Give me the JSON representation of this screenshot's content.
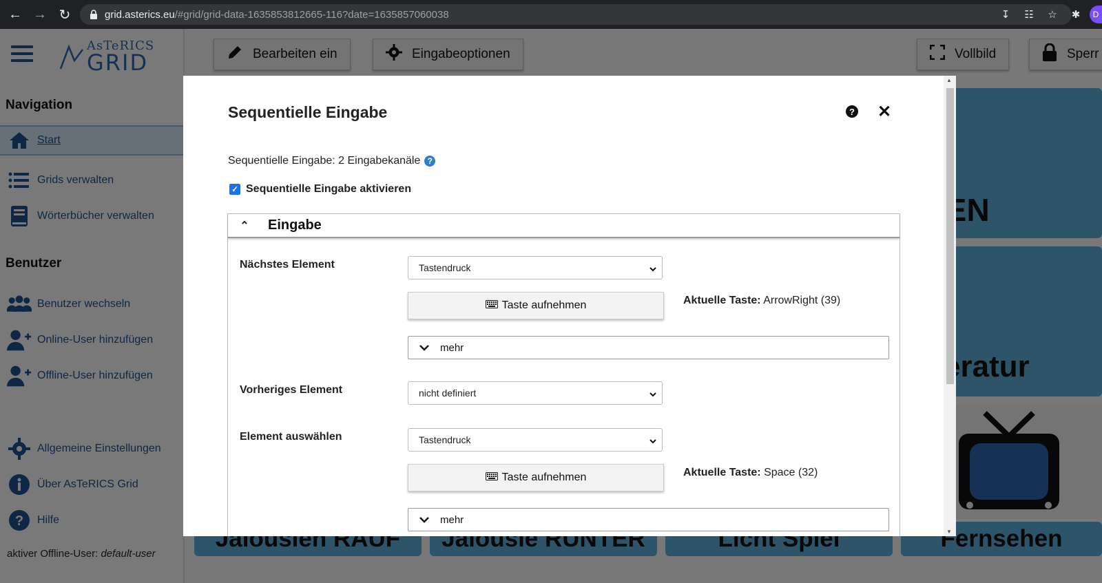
{
  "browser": {
    "url_host": "grid.asterics.eu",
    "url_path": "/#grid/grid-data-1635853812665-116?date=1635857060038",
    "profile_initial": "D"
  },
  "logo": {
    "sup": "AsTeRICS",
    "main": "GRID"
  },
  "sidebar": {
    "nav_title": "Navigation",
    "nav_items": [
      {
        "label": "Start",
        "icon": "home-icon"
      },
      {
        "label": "Grids verwalten",
        "icon": "list-icon"
      },
      {
        "label": "Wörterbücher verwalten",
        "icon": "book-icon"
      }
    ],
    "user_title": "Benutzer",
    "user_items": [
      {
        "label": "Benutzer wechseln",
        "icon": "users-icon"
      },
      {
        "label": "Online-User hinzufügen",
        "icon": "user-plus-icon"
      },
      {
        "label": "Offline-User hinzufügen",
        "icon": "user-plus-icon"
      }
    ],
    "bottom_items": [
      {
        "label": "Allgemeine Einstellungen",
        "icon": "gear-icon"
      },
      {
        "label": "Über AsTeRICS Grid",
        "icon": "info-icon"
      },
      {
        "label": "Hilfe",
        "icon": "help-icon"
      }
    ],
    "offline_user_label": "aktiver Offline-User:",
    "offline_user_name": "default-user"
  },
  "toolbar": {
    "edit_label": "Bearbeiten ein",
    "input_options_label": "Eingabeoptionen",
    "fullscreen_label": "Vollbild",
    "lock_label": "Sperr"
  },
  "grid_tiles": {
    "tile_1": "IEN",
    "tile_2": "eratur",
    "bottom": [
      "Jalousien RAUF",
      "Jalousie RUNTER",
      "Licht Spiel",
      "Fernsehen"
    ]
  },
  "modal": {
    "title": "Sequentielle Eingabe",
    "subline": "Sequentielle Eingabe: 2 Eingabekanäle",
    "enable_checkbox_label": "Sequentielle Eingabe aktivieren",
    "enable_checked": true,
    "section_title": "Eingabe",
    "rows": [
      {
        "label": "Nächstes Element",
        "select_value": "Tastendruck",
        "record_label": "Taste aufnehmen",
        "current_key_label": "Aktuelle Taste:",
        "current_key_value": "ArrowRight (39)",
        "more_label": "mehr"
      },
      {
        "label": "Vorheriges Element",
        "select_value": "nicht definiert"
      },
      {
        "label": "Element auswählen",
        "select_value": "Tastendruck",
        "record_label": "Taste aufnehmen",
        "current_key_label": "Aktuelle Taste:",
        "current_key_value": "Space (32)",
        "more_label": "mehr"
      }
    ]
  },
  "colors": {
    "brand_blue": "#2b65a8",
    "tile_blue": "#5ba9d0",
    "checkbox_blue": "#1a73e8"
  }
}
